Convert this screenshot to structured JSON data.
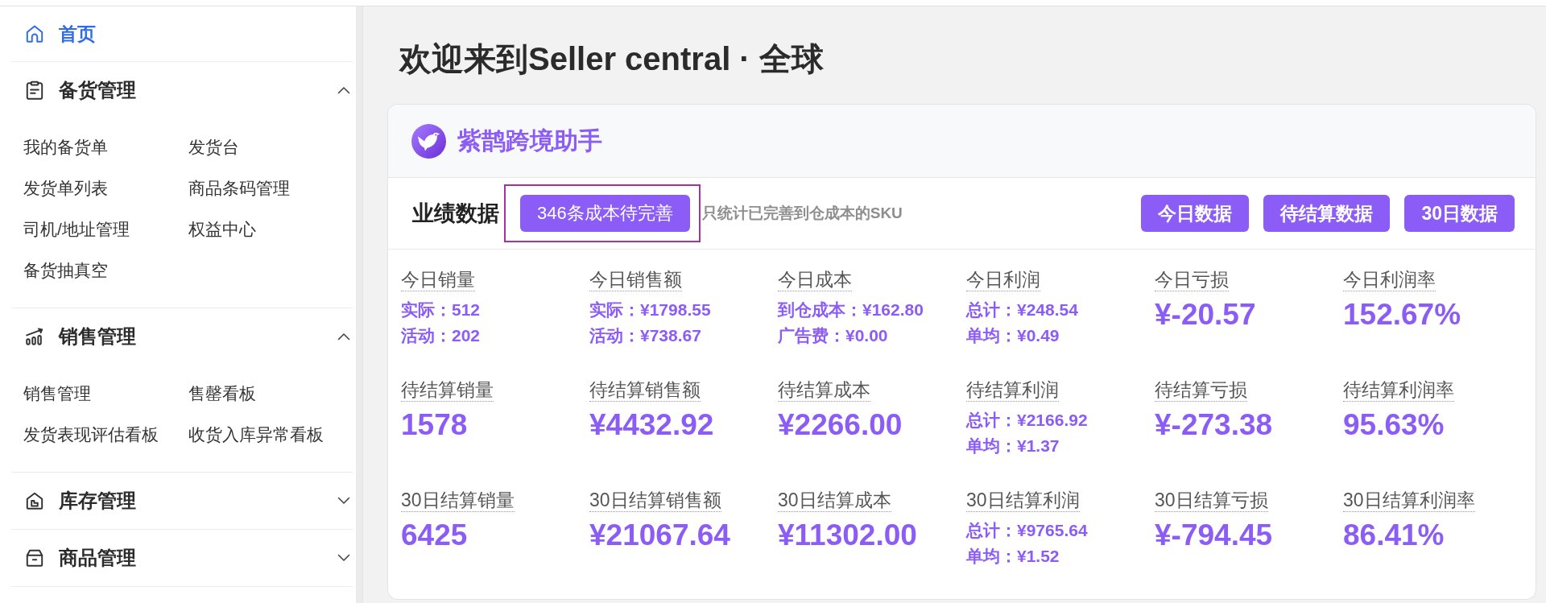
{
  "sidebar": {
    "home": {
      "label": "首页",
      "selected": true
    },
    "groups": [
      {
        "label": "备货管理",
        "expanded": true,
        "items": [
          {
            "label": "我的备货单",
            "selected": false
          },
          {
            "label": "发货台",
            "selected": false
          },
          {
            "label": "发货单列表",
            "selected": false
          },
          {
            "label": "商品条码管理",
            "selected": false
          },
          {
            "label": "司机/地址管理",
            "selected": false
          },
          {
            "label": "权益中心",
            "selected": false
          },
          {
            "label": "备货抽真空",
            "selected": false
          }
        ]
      },
      {
        "label": "销售管理",
        "expanded": true,
        "items": [
          {
            "label": "销售管理",
            "selected": false
          },
          {
            "label": "售罄看板",
            "selected": false
          },
          {
            "label": "发货表现评估看板",
            "selected": false
          },
          {
            "label": "收货入库异常看板",
            "selected": false
          }
        ]
      },
      {
        "label": "库存管理",
        "expanded": false
      },
      {
        "label": "商品管理",
        "expanded": false
      }
    ]
  },
  "page_title": "欢迎来到Seller central · 全球",
  "assistant": {
    "name": "紫鹊跨境助手",
    "performance": {
      "title": "业绩数据",
      "cost_alert": {
        "label": "346条成本待完善",
        "highlighted": true
      },
      "note": "只统计已完善到仓成本的SKU",
      "period_buttons": [
        "今日数据",
        "待结算数据",
        "30日数据"
      ],
      "metrics": [
        {
          "label": "今日销量",
          "kind": "breakdown",
          "lines": [
            "实际：512",
            "活动：202"
          ]
        },
        {
          "label": "今日销售额",
          "kind": "breakdown",
          "lines": [
            "实际：¥1798.55",
            "活动：¥738.67"
          ]
        },
        {
          "label": "今日成本",
          "kind": "breakdown",
          "lines": [
            "到仓成本：¥162.80",
            "广告费：¥0.00"
          ]
        },
        {
          "label": "今日利润",
          "kind": "breakdown",
          "lines": [
            "总计：¥248.54",
            "单均：¥0.49"
          ]
        },
        {
          "label": "今日亏损",
          "kind": "value",
          "value": "¥-20.57"
        },
        {
          "label": "今日利润率",
          "kind": "value",
          "value": "152.67%"
        },
        {
          "label": "待结算销量",
          "kind": "value",
          "value": "1578"
        },
        {
          "label": "待结算销售额",
          "kind": "value",
          "value": "¥4432.92"
        },
        {
          "label": "待结算成本",
          "kind": "value",
          "value": "¥2266.00"
        },
        {
          "label": "待结算利润",
          "kind": "breakdown",
          "lines": [
            "总计：¥2166.92",
            "单均：¥1.37"
          ]
        },
        {
          "label": "待结算亏损",
          "kind": "value",
          "value": "¥-273.38"
        },
        {
          "label": "待结算利润率",
          "kind": "value",
          "value": "95.63%"
        },
        {
          "label": "30日结算销量",
          "kind": "value",
          "value": "6425"
        },
        {
          "label": "30日结算销售额",
          "kind": "value",
          "value": "¥21067.64"
        },
        {
          "label": "30日结算成本",
          "kind": "value",
          "value": "¥11302.00"
        },
        {
          "label": "30日结算利润",
          "kind": "breakdown",
          "lines": [
            "总计：¥9765.64",
            "单均：¥1.52"
          ]
        },
        {
          "label": "30日结算亏损",
          "kind": "value",
          "value": "¥-794.45"
        },
        {
          "label": "30日结算利润率",
          "kind": "value",
          "value": "86.41%"
        }
      ]
    }
  }
}
